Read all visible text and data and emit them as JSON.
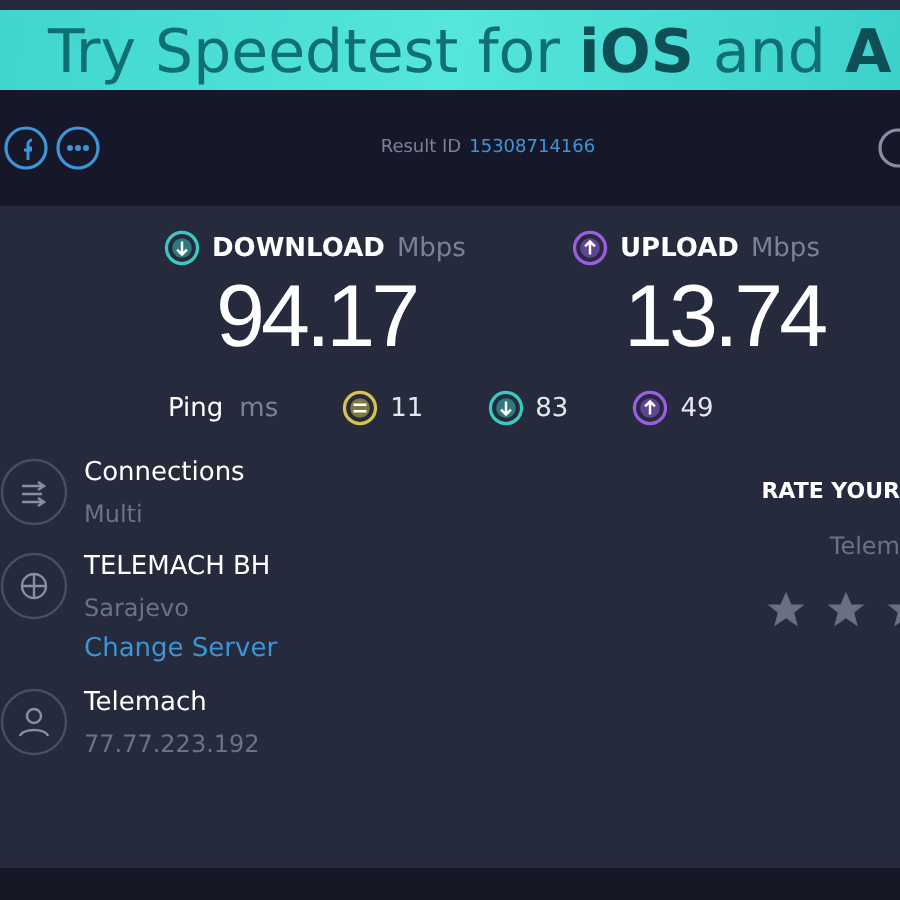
{
  "banner": {
    "text": "Try Speedtest for **iOS** and **A**"
  },
  "header": {
    "result_label": "Result ID",
    "result_id": "15308714166"
  },
  "metrics": [
    {
      "kind": "download",
      "label": "DOWNLOAD",
      "unit": "Mbps",
      "value": "94.17"
    },
    {
      "kind": "upload",
      "label": "UPLOAD",
      "unit": "Mbps",
      "value": "13.74"
    }
  ],
  "ping": {
    "label": "Ping",
    "unit": "ms",
    "readings": [
      {
        "kind": "idle",
        "value": "11"
      },
      {
        "kind": "download",
        "value": "83"
      },
      {
        "kind": "upload",
        "value": "49"
      }
    ]
  },
  "details": [
    {
      "kind": "connections",
      "title": "Connections",
      "subtitle": "Multi"
    },
    {
      "kind": "server",
      "title": "TELEMACH BH",
      "subtitle": "Sarajevo",
      "link": "Change Server"
    },
    {
      "kind": "provider",
      "title": "Telemach",
      "subtitle": "77.77.223.192"
    }
  ],
  "rating": {
    "title": "RATE YOUR",
    "subtitle": "Telem"
  }
}
